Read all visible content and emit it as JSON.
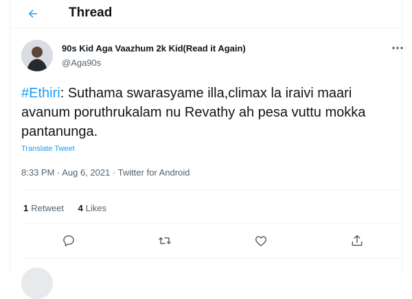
{
  "header": {
    "title": "Thread"
  },
  "author": {
    "display_name": "90s Kid Aga Vaazhum 2k Kid(Read it Again)",
    "handle": "@Aga90s"
  },
  "tweet": {
    "hashtag": "#Ethiri",
    "text": ": Suthama swarasyame illa,climax la iraivi maari avanum poruthrukalam nu Revathy ah pesa vuttu mokka pantanunga.",
    "translate_label": "Translate Tweet",
    "timestamp": "8:33 PM · Aug 6, 2021 · Twitter for Android"
  },
  "stats": {
    "retweets_count": "1",
    "retweets_label": "Retweet",
    "likes_count": "4",
    "likes_label": "Likes"
  },
  "icons": {
    "back": "back-arrow-icon",
    "more": "more-icon",
    "reply": "reply-icon",
    "retweet": "retweet-icon",
    "like": "heart-icon",
    "share": "share-icon"
  },
  "colors": {
    "accent": "#1d9bf0",
    "text": "#0f1419",
    "muted": "#536471",
    "border": "#eff3f4"
  }
}
